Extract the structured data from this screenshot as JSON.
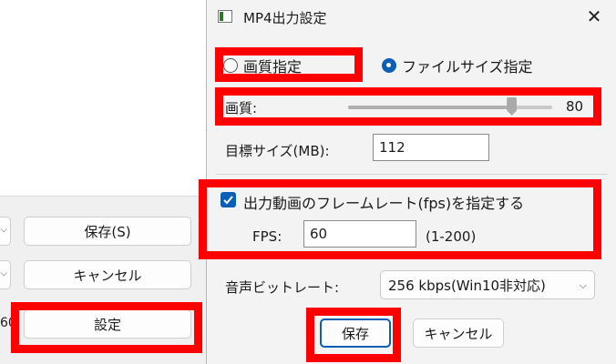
{
  "background_window": {
    "row1_partial": "",
    "save_label": "保存(S)",
    "cancel_label": "キャンセル",
    "row3_partial": "60",
    "settings_label": "設定"
  },
  "dialog": {
    "title": "MP4出力設定",
    "close_glyph": "✕",
    "mode": {
      "quality_label": "画質指定",
      "filesize_label": "ファイルサイズ指定",
      "selected": "ファイルサイズ指定"
    },
    "quality": {
      "label": "画質:",
      "value": "80",
      "slider_fraction": 0.8
    },
    "target_size": {
      "label": "目標サイズ(MB):",
      "value": "112"
    },
    "framerate": {
      "checkbox_label": "出力動画のフレームレート(fps)を指定する",
      "checked": true,
      "fps_label": "FPS:",
      "fps_value": "60",
      "range_hint": "(1-200)"
    },
    "audio": {
      "label": "音声ビットレート:",
      "selected": "256 kbps(Win10非対応)"
    },
    "buttons": {
      "save": "保存",
      "cancel": "キャンセル"
    }
  },
  "colors": {
    "accent": "#0a5fb5",
    "highlight": "#ff0000",
    "dialog_bg": "#f3f3f3"
  },
  "icons": [
    "app-window-icon",
    "close-icon",
    "chevron-down-icon",
    "checkmark-icon"
  ]
}
